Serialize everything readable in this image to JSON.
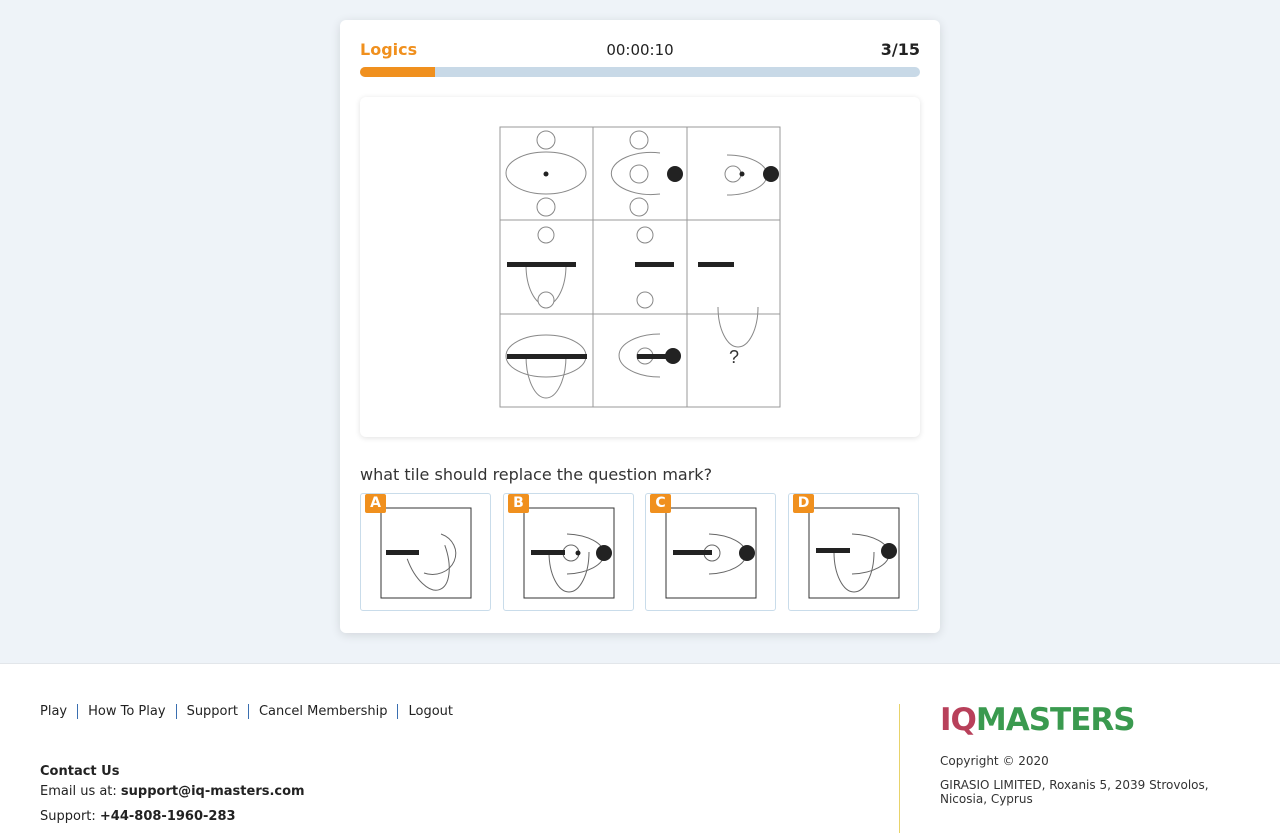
{
  "quiz": {
    "category": "Logics",
    "timer": "00:00:10",
    "counter": "3/15",
    "progress_fraction": 0.134,
    "accent_color": "#f0901e",
    "question": "what tile should replace the question mark?",
    "missing_tile_mark": "?",
    "options": [
      {
        "letter": "A"
      },
      {
        "letter": "B"
      },
      {
        "letter": "C"
      },
      {
        "letter": "D"
      }
    ]
  },
  "footer": {
    "nav": [
      "Play",
      "How To Play",
      "Support",
      "Cancel Membership",
      "Logout"
    ],
    "contact_title": "Contact Us",
    "email_prefix": "Email us at: ",
    "email": "support@iq-masters.com",
    "phone_prefix": "Support: ",
    "phone": "+44-808-1960-283",
    "logo_iq": "IQ",
    "logo_masters": "MASTERS",
    "copyright": "Copyright © 2020",
    "address": "GIRASIO LIMITED, Roxanis 5, 2039 Strovolos, Nicosia, Cyprus"
  }
}
